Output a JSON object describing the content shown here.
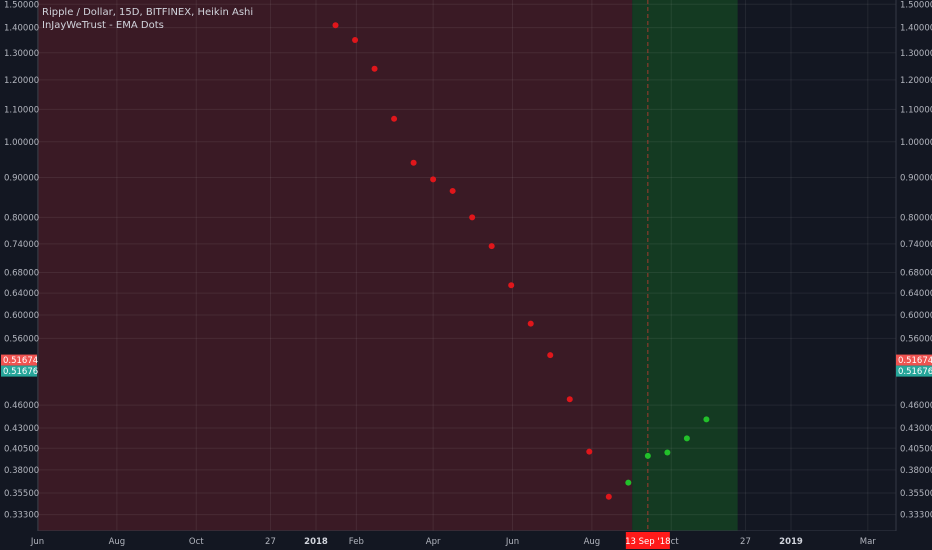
{
  "header": {
    "symbol_line": "Ripple / Dollar, 15D, BITFINEX, Heikin Ashi",
    "indicator_line": "InJayWeTrust - EMA Dots"
  },
  "colors": {
    "background": "#131722",
    "bearish_zone": "#3a1a25",
    "bullish_zone": "#143a22",
    "bearish_dot": "#e0161b",
    "bullish_dot": "#22c02a",
    "price_label_red": "#ef5350",
    "price_label_teal": "#26a69a",
    "date_label": "#ff1a1a"
  },
  "price_labels": {
    "red": "0.51674",
    "teal": "0.51676"
  },
  "crosshair_date": "13 Sep '18",
  "chart_data": {
    "type": "scatter",
    "title": "Ripple / Dollar, 15D, BITFINEX, Heikin Ashi",
    "scale": "log",
    "ylim": [
      0.323,
      1.51
    ],
    "y_ticks": [
      "1.50000",
      "1.40000",
      "1.30000",
      "1.20000",
      "1.10000",
      "1.00000",
      "0.90000",
      "0.80000",
      "0.74000",
      "0.68000",
      "0.64000",
      "0.60000",
      "0.56000",
      "0.46000",
      "0.43000",
      "0.40500",
      "0.38000",
      "0.35500",
      "0.33300"
    ],
    "x_ticks": [
      {
        "label": "Jun",
        "date": "2017-06-01",
        "bold": false
      },
      {
        "label": "Aug",
        "date": "2017-08-01",
        "bold": false
      },
      {
        "label": "Oct",
        "date": "2017-10-01",
        "bold": false
      },
      {
        "label": "27",
        "date": "2017-11-27",
        "bold": false
      },
      {
        "label": "2018",
        "date": "2018-01-01",
        "bold": true
      },
      {
        "label": "Feb",
        "date": "2018-02-01",
        "bold": false
      },
      {
        "label": "Apr",
        "date": "2018-04-01",
        "bold": false
      },
      {
        "label": "Jun",
        "date": "2018-06-01",
        "bold": false
      },
      {
        "label": "Aug",
        "date": "2018-08-01",
        "bold": false
      },
      {
        "label": "Oct",
        "date": "2018-10-01",
        "bold": false
      },
      {
        "label": "27",
        "date": "2018-11-27",
        "bold": false
      },
      {
        "label": "2019",
        "date": "2019-01-01",
        "bold": true
      },
      {
        "label": "Mar",
        "date": "2019-03-01",
        "bold": false
      }
    ],
    "zones": [
      {
        "name": "bearish",
        "from": "2017-05-10",
        "to": "2018-09-01"
      },
      {
        "name": "bullish",
        "from": "2018-09-01",
        "to": "2018-11-21"
      }
    ],
    "crosshair_x": "2018-09-13",
    "series": [
      {
        "color": "bearish",
        "points": [
          {
            "x": "2018-01-16",
            "y": 1.41
          },
          {
            "x": "2018-01-31",
            "y": 1.35
          },
          {
            "x": "2018-02-15",
            "y": 1.24
          },
          {
            "x": "2018-03-02",
            "y": 1.07
          },
          {
            "x": "2018-03-17",
            "y": 0.94
          },
          {
            "x": "2018-04-01",
            "y": 0.895
          },
          {
            "x": "2018-04-16",
            "y": 0.865
          },
          {
            "x": "2018-05-01",
            "y": 0.8
          },
          {
            "x": "2018-05-16",
            "y": 0.735
          },
          {
            "x": "2018-05-31",
            "y": 0.655
          },
          {
            "x": "2018-06-15",
            "y": 0.585
          },
          {
            "x": "2018-06-30",
            "y": 0.533
          },
          {
            "x": "2018-07-15",
            "y": 0.468
          },
          {
            "x": "2018-07-30",
            "y": 0.401
          },
          {
            "x": "2018-08-14",
            "y": 0.351
          }
        ]
      },
      {
        "color": "bullish",
        "points": [
          {
            "x": "2018-08-29",
            "y": 0.366
          },
          {
            "x": "2018-09-13",
            "y": 0.396
          },
          {
            "x": "2018-09-28",
            "y": 0.4
          },
          {
            "x": "2018-10-13",
            "y": 0.417
          },
          {
            "x": "2018-10-28",
            "y": 0.441
          }
        ]
      }
    ]
  }
}
